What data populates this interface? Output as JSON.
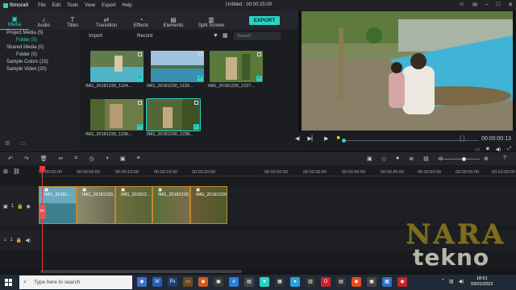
{
  "app": {
    "logo_text": "filmora9",
    "menu": [
      "File",
      "Edit",
      "Tools",
      "View",
      "Export",
      "Help"
    ],
    "window_title": "Untitled : 00:00:25:00"
  },
  "toolbar": {
    "tabs": [
      {
        "label": "Media",
        "icon": "folder-icon",
        "active": true
      },
      {
        "label": "Audio",
        "icon": "music-note-icon"
      },
      {
        "label": "Titles",
        "icon": "text-icon"
      },
      {
        "label": "Transition",
        "icon": "transition-icon"
      },
      {
        "label": "Effects",
        "icon": "effects-icon"
      },
      {
        "label": "Elements",
        "icon": "elements-icon"
      },
      {
        "label": "Split Screen",
        "icon": "split-screen-icon"
      }
    ],
    "export_label": "EXPORT"
  },
  "library": {
    "items": [
      {
        "label": "Project Media (5)",
        "sub": false,
        "selected": false
      },
      {
        "label": "Folder (5)",
        "sub": true,
        "selected": true
      },
      {
        "label": "Shared Media (0)",
        "sub": false,
        "selected": false
      },
      {
        "label": "Folder (0)",
        "sub": true,
        "selected": false
      },
      {
        "label": "Sample Colors (15)",
        "sub": false,
        "selected": false
      },
      {
        "label": "Sample Video (20)",
        "sub": false,
        "selected": false
      }
    ]
  },
  "media": {
    "import_label": "Import",
    "record_label": "Record",
    "search_placeholder": "Search",
    "clips": [
      {
        "name": "IMG_20181230_1124...",
        "color": "#6d8a5a"
      },
      {
        "name": "IMG_20181230_1130...",
        "color": "#7fa6c8"
      },
      {
        "name": "IMG_20181230_1227...",
        "color": "#5e7a45"
      },
      {
        "name": "IMG_20181230_1236...",
        "color": "#6b7c4a"
      },
      {
        "name": "IMG_20181230_1238...",
        "color": "#5a6a3c"
      }
    ]
  },
  "preview": {
    "timecode": "00:00:00:13",
    "brackets": "{  }"
  },
  "timeline": {
    "ruler": [
      "00:00:00:00",
      "00:00:05:00",
      "00:00:10:00",
      "00:00:15:00",
      "00:00:20:00",
      "00:00:30:00",
      "00:00:35:00",
      "00:00:40:00",
      "00:00:45:00",
      "00:00:50:00",
      "00:00:55:00",
      "00:01:00:00"
    ],
    "video_track_label": "1",
    "audio_track_label": "1",
    "clips": [
      {
        "name": "IMG_20181...",
        "color": "#4b7a8c"
      },
      {
        "name": "IMG_20181230_1...",
        "color": "#7a7a5c"
      },
      {
        "name": "IMG_201812...",
        "color": "#6b6a3e"
      },
      {
        "name": "IMG_20181230_12...",
        "color": "#5d6e3a"
      },
      {
        "name": "IMG_20181230_12...",
        "color": "#6b5a34"
      }
    ]
  },
  "taskbar": {
    "search_placeholder": "Type here to search",
    "time": "18:51",
    "date": "03/01/2022"
  },
  "watermark": {
    "line1": "NARA",
    "line2": "tekno"
  },
  "colors": {
    "accent": "#2bd2c4",
    "playhead": "#e23c3c",
    "clip_border": "#c28a2c"
  }
}
